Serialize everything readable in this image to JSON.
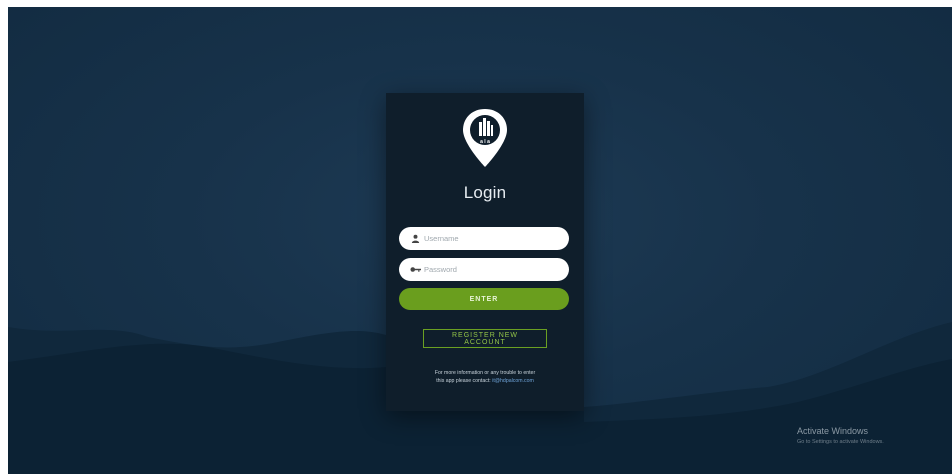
{
  "login": {
    "title": "Login",
    "logo_text": "a l a",
    "username_placeholder": "Username",
    "password_placeholder": "Password",
    "enter_label": "ENTER",
    "register_label": "REGISTER NEW ACCOUNT",
    "info_line1": "For more information or any trouble to enter",
    "info_line2": "this app please contact:",
    "info_email": "it@hdpalcom.com"
  },
  "overlay": {
    "activate_title": "Activate Windows",
    "activate_sub": "Go to Settings to activate Windows."
  },
  "colors": {
    "background": "#17324a",
    "card": "#0f1e2b",
    "accent_green": "#6a9e1e",
    "text_light": "#e6ecf1"
  },
  "icons": {
    "username": "user-icon",
    "password": "key-icon",
    "logo": "location-pin-building-icon"
  }
}
